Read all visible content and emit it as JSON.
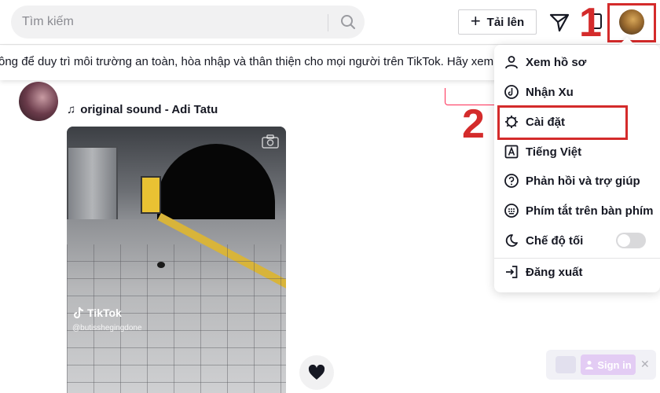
{
  "header": {
    "search_placeholder": "Tìm kiếm",
    "upload_label": "Tải lên",
    "upload_plus": "+"
  },
  "notice": {
    "text": "ông để duy trì môi trường an toàn, hòa nhập và thân thiện cho mọi người trên TikTok. Hãy xem n"
  },
  "post": {
    "sound_icon": "♫",
    "sound": "original sound - Adi Tatu",
    "watermark_brand": "TikTok",
    "watermark_handle": "@butisshegingdone",
    "like_icon": "♥"
  },
  "menu": {
    "items": [
      {
        "label": "Xem hồ sơ",
        "icon": "person-icon"
      },
      {
        "label": "Nhận Xu",
        "icon": "tiktok-coin-icon"
      },
      {
        "label": "Cài đặt",
        "icon": "gear-icon"
      },
      {
        "label": "Tiếng Việt",
        "icon": "language-icon"
      },
      {
        "label": "Phản hồi và trợ giúp",
        "icon": "help-icon"
      },
      {
        "label": "Phím tắt trên bàn phím",
        "icon": "keyboard-icon"
      },
      {
        "label": "Chế độ tối",
        "icon": "moon-icon"
      },
      {
        "label": "Đăng xuất",
        "icon": "logout-icon"
      }
    ],
    "dark_mode_on": false
  },
  "annotations": {
    "step1": "1",
    "step2": "2",
    "highlight_color": "#d42b2b"
  },
  "signin": {
    "label": "Sign in"
  }
}
